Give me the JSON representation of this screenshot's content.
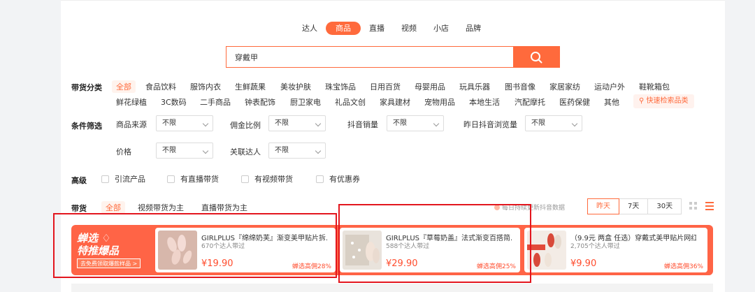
{
  "tabs": [
    "达人",
    "商品",
    "直播",
    "视频",
    "小店",
    "品牌"
  ],
  "search": {
    "value": "穿戴甲"
  },
  "categories": {
    "label": "带货分类",
    "row1": [
      "全部",
      "食品饮料",
      "服饰内衣",
      "生鲜蔬果",
      "美妆护肤",
      "珠宝饰品",
      "日用百货",
      "母婴用品",
      "玩具乐器",
      "图书音像",
      "家居家纺",
      "运动户外",
      "鞋靴箱包"
    ],
    "row2": [
      "鲜花绿植",
      "3C数码",
      "二手商品",
      "钟表配饰",
      "厨卫家电",
      "礼品文创",
      "家具建材",
      "宠物用品",
      "本地生活",
      "汽配摩托",
      "医药保健",
      "其他"
    ],
    "quick": "快速检索品类"
  },
  "filters": {
    "label": "条件筛选",
    "source_label": "商品来源",
    "source_value": "不限",
    "commission_label": "佣金比例",
    "commission_value": "不限",
    "sales_label": "抖音销量",
    "sales_value": "不限",
    "views_label": "昨日抖音浏览量",
    "views_value": "不限",
    "price_label": "价格",
    "price_value": "不限",
    "influencer_label": "关联达人",
    "influencer_value": "不限"
  },
  "advanced": {
    "label": "高级",
    "options": [
      "引流产品",
      "有直播带货",
      "有视频带货",
      "有优惠券"
    ]
  },
  "mode": {
    "label": "带货",
    "options": [
      "全部",
      "视频带货为主",
      "直播带货为主"
    ],
    "update_note": "每日持续更新抖音数据",
    "ranges": [
      "昨天",
      "7天",
      "30天"
    ]
  },
  "promo": {
    "line1": "蝉选",
    "line2": "特推爆品",
    "link": "去免费领取爆款样品 >"
  },
  "products": [
    {
      "title": "GIRLPLUS『绵绵奶芙』渐变美甲贴片拆...",
      "sub": "670个达人带过",
      "price": "¥19.90",
      "comm": "蝉选高佣28%"
    },
    {
      "title": "GIRLPLUS『草莓奶盖』法式渐变百搭简...",
      "sub": "588个达人带过",
      "price": "¥29.90",
      "comm": "蝉选高佣25%"
    },
    {
      "title": "（9.9元 两盒 任选）穿戴式美甲贴片网红...",
      "sub": "2,705个达人带过",
      "price": "¥9.90",
      "comm": "蝉选高佣36%"
    }
  ],
  "colors": {
    "accent": "#ff6a3c",
    "annotation": "#e3161e"
  }
}
